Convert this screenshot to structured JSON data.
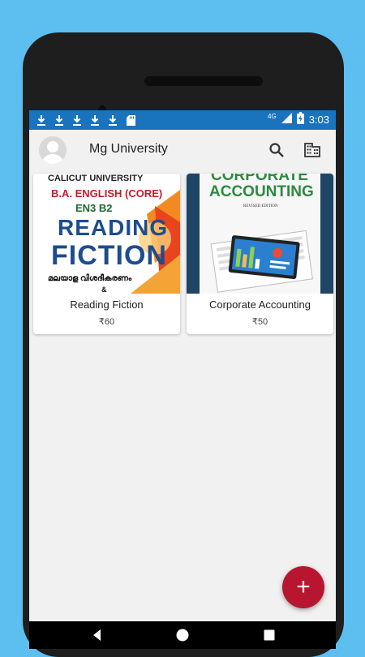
{
  "status_bar": {
    "time": "3:03",
    "network": "4G",
    "notification_icons": [
      "download-icon",
      "download-icon",
      "download-icon",
      "download-icon",
      "download-icon",
      "sd-card-icon"
    ]
  },
  "app_bar": {
    "title": "Mg University",
    "icons": [
      "avatar-placeholder-icon",
      "search-icon",
      "building-icon"
    ]
  },
  "books": [
    {
      "title": "Reading Fiction",
      "price": "₹60",
      "cover": {
        "line1": "CALICUT UNIVERSITY",
        "line2": "B.A. ENGLISH (CORE)",
        "line3": "EN3 B2",
        "line4": "READING",
        "line5": "FICTION",
        "line6": "മലയാള വിശദീകരണം",
        "line7": "&"
      }
    },
    {
      "title": "Corporate Accounting",
      "price": "₹50",
      "cover": {
        "line1": "CORPORATE",
        "line2": "ACCOUNTING",
        "line3": "REVISED EDITION"
      }
    }
  ],
  "fab": {
    "label": "+"
  },
  "colors": {
    "status_bar": "#1a73bd",
    "fab": "#b71530",
    "background": "#5cbff0"
  }
}
